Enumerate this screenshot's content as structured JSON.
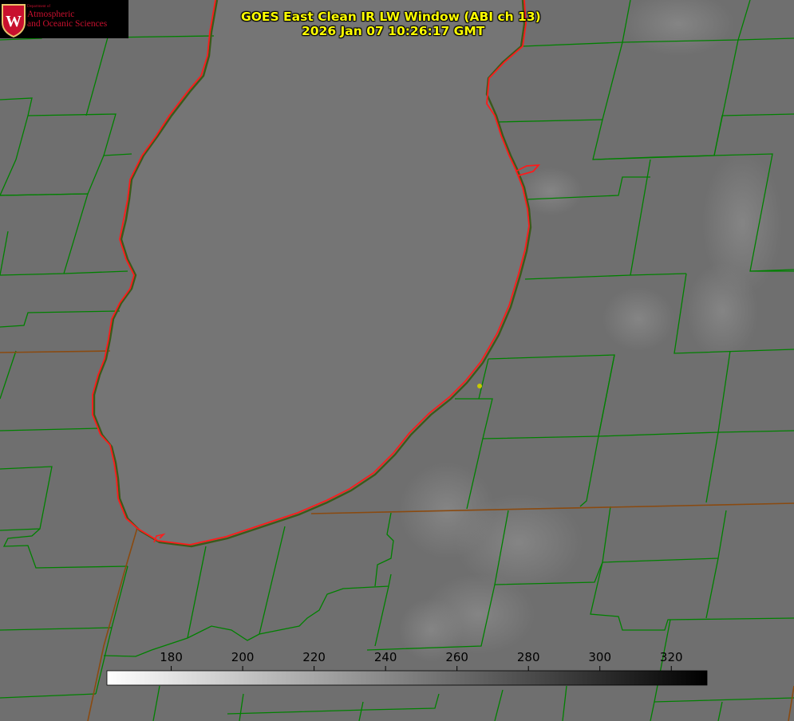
{
  "title": {
    "line1": "GOES East Clean IR LW Window (ABI ch 13)",
    "line2": "2026 Jan 07 10:26:17 GMT"
  },
  "logo": {
    "small_text": "Department of",
    "line1": "Atmospheric",
    "line2": "and Oceanic Sciences",
    "crest_letter": "W"
  },
  "colorbar": {
    "tick_labels": [
      "180",
      "200",
      "220",
      "240",
      "260",
      "280",
      "300",
      "320"
    ],
    "min_value": 162,
    "max_value": 330,
    "gradient_from": "#ffffff",
    "gradient_to": "#000000"
  },
  "colors": {
    "background": "#6f6f6f",
    "lake": "#747474",
    "shoreline": "#ff1a1a",
    "county_lines": "#008000",
    "state_line": "#7a3b00",
    "title_text": "#ffff00",
    "logo_text": "#c8102e",
    "station_marker": "#c8c800"
  }
}
